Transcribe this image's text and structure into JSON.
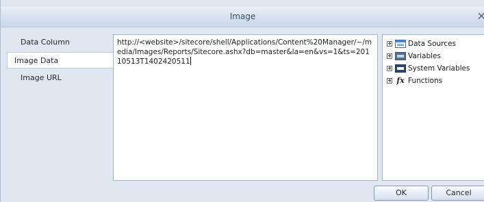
{
  "window": {
    "title": "Image",
    "close_glyph": "✕"
  },
  "tabs": [
    {
      "label": "Data Column",
      "active": false
    },
    {
      "label": "Image Data",
      "active": true
    },
    {
      "label": "Image URL",
      "active": false
    }
  ],
  "editor": {
    "value": "http://<website>/sitecore/shell/Applications/Content%20Manager/~/media/Images/Reports/Sitecore.ashx?db=master&la=en&vs=1&ts=20110513T1402420511"
  },
  "tree": {
    "items": [
      {
        "label": "Data Sources",
        "icon": "data-sources-icon"
      },
      {
        "label": "Variables",
        "icon": "variables-icon"
      },
      {
        "label": "System Variables",
        "icon": "system-variables-icon"
      },
      {
        "label": "Functions",
        "icon": "functions-icon",
        "glyph": "fx"
      }
    ]
  },
  "buttons": {
    "ok_label": "OK",
    "cancel_label": "Cancel"
  }
}
